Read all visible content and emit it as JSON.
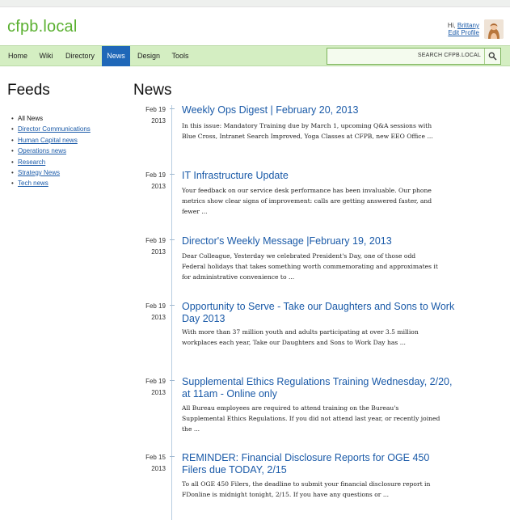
{
  "site": {
    "logo": "cfpb.local"
  },
  "user": {
    "greeting_prefix": "Hi, ",
    "name": "Brittany",
    "edit_profile": "Edit Profile"
  },
  "nav": {
    "items": [
      {
        "label": "Home",
        "active": false
      },
      {
        "label": "Wiki",
        "active": false
      },
      {
        "label": "Directory",
        "active": false
      },
      {
        "label": "News",
        "active": true
      },
      {
        "label": "Design",
        "active": false
      },
      {
        "label": "Tools",
        "active": false
      }
    ],
    "search_label": "SEARCH CFPB.LOCAL"
  },
  "feeds": {
    "heading": "Feeds",
    "items": [
      {
        "label": "All News",
        "current": true
      },
      {
        "label": "Director Communications",
        "current": false
      },
      {
        "label": "Human Capital news",
        "current": false
      },
      {
        "label": "Operations news",
        "current": false
      },
      {
        "label": "Research",
        "current": false
      },
      {
        "label": "Strategy News",
        "current": false
      },
      {
        "label": "Tech news",
        "current": false
      }
    ]
  },
  "news": {
    "heading": "News",
    "posts": [
      {
        "date_md": "Feb 19",
        "date_y": "2013",
        "title": "Weekly Ops Digest | February 20, 2013",
        "excerpt": "In this issue: Mandatory Training due by March 1, upcoming Q&A sessions with Blue Cross, Intranet Search Improved, Yoga Classes at CFPB, new EEO Office ..."
      },
      {
        "date_md": "Feb 19",
        "date_y": "2013",
        "title": "IT Infrastructure Update",
        "excerpt": "Your feedback on our service desk performance has been invaluable. Our phone metrics show clear signs of improvement: calls are getting answered faster, and fewer ..."
      },
      {
        "date_md": "Feb 19",
        "date_y": "2013",
        "title": "Director's Weekly Message |February 19, 2013",
        "excerpt": "Dear Colleague, Yesterday we celebrated President's Day, one of those odd Federal holidays that takes something worth commemorating and approximates it for administrative convenience to ..."
      },
      {
        "date_md": "Feb 19",
        "date_y": "2013",
        "title": "Opportunity to Serve - Take our Daughters and Sons to Work Day 2013",
        "excerpt": "With more than 37 million youth and adults participating at over 3.5 million workplaces each year, Take our Daughters and Sons to Work Day has ..."
      },
      {
        "date_md": "Feb 19",
        "date_y": "2013",
        "title": "Supplemental Ethics Regulations Training Wednesday, 2/20, at 11am - Online only",
        "excerpt": "All Bureau employees are required to attend training on the Bureau's Supplemental Ethics Regulations. If you did not attend last year, or recently joined the ..."
      },
      {
        "date_md": "Feb 15",
        "date_y": "2013",
        "title": "REMINDER: Financial Disclosure Reports for OGE 450 Filers due TODAY, 2/15",
        "excerpt": "To all OGE 450 Filers, the deadline to submit your financial disclosure report in FDonline is midnight tonight, 2/15. If you have any questions or ..."
      }
    ]
  },
  "colors": {
    "brand_green": "#5ab030",
    "nav_bg": "#d4eec2",
    "link_blue": "#1a5aa8",
    "active_tab": "#1f67b8"
  },
  "icons": {
    "search": "search-icon",
    "avatar": "user-avatar"
  }
}
